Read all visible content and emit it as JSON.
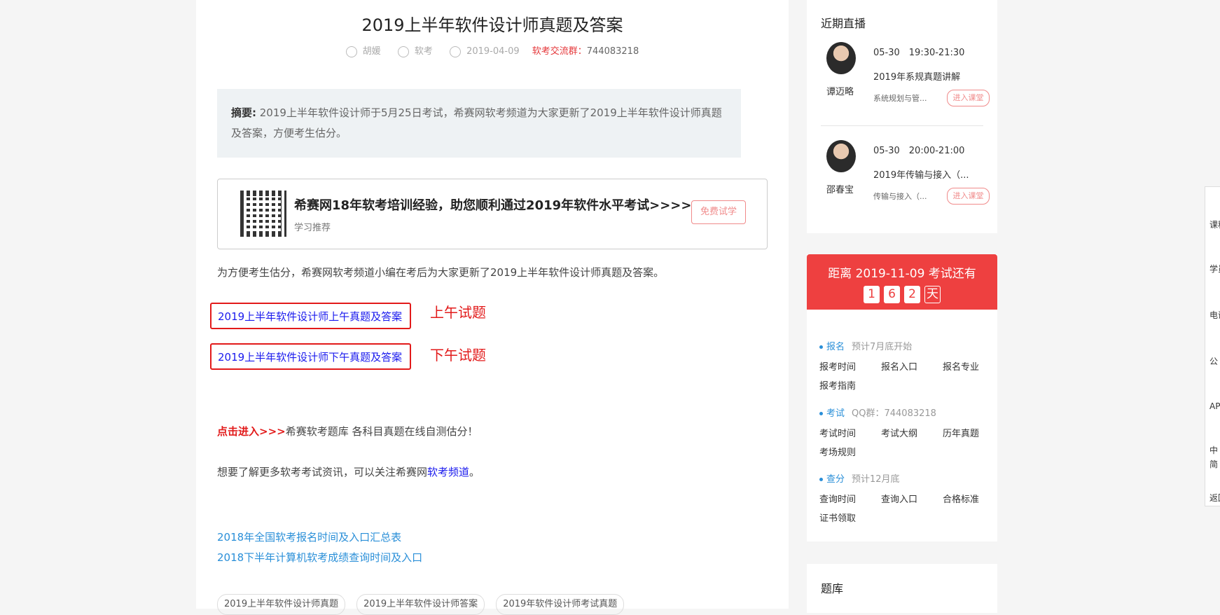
{
  "article": {
    "title": "2019上半年软件设计师真题及答案",
    "author": "胡媛",
    "category": "软考",
    "date": "2019-04-09",
    "group_label": "软考交流群：",
    "group_number": "744083218",
    "abstract_label": "摘要:",
    "abstract_text": " 2019上半年软件设计师于5月25日考试，希赛网软考频道为大家更新了2019上半年软件设计师真题及答案，方便考生估分。",
    "promo": {
      "title": "希赛网18年软考培训经验，助您顺利通过2019年软件水平考试>>>>",
      "subtitle": "学习推荐",
      "button": "免费试学"
    },
    "intro": "为方便考生估分，希赛网软考频道小编在考后为大家更新了2019上半年软件设计师真题及答案。",
    "link_morning": "2019上半年软件设计师上午真题及答案",
    "link_afternoon": "2019上半年软件设计师下午真题及答案",
    "label_morning": "上午试题",
    "label_afternoon": "下午试题",
    "cta_link": "点击进入>>>",
    "cta_text": "希赛软考题库 各科目真题在线自测估分！",
    "follow_text": "想要了解更多软考考试资讯，可以关注希赛网",
    "follow_link": "软考频道",
    "follow_end": "。",
    "related": [
      "2018年全国软考报名时间及入口汇总表",
      "2018下半年计算机软考成绩查询时间及入口"
    ],
    "tags": [
      "2019上半年软件设计师真题",
      "2019上半年软件设计师答案",
      "2019年软件设计师考试真题"
    ]
  },
  "live": {
    "heading": "近期直播",
    "items": [
      {
        "teacher": "谭迈略",
        "time": "05-30　19:30-21:30",
        "course": "2019年系规真题讲解",
        "sub": "系统规划与管...",
        "button": "进入课堂"
      },
      {
        "teacher": "邵春宝",
        "time": "05-30　20:00-21:00",
        "course": "2019年传输与接入（...",
        "sub": "传输与接入（...",
        "button": "进入课堂"
      }
    ]
  },
  "countdown": {
    "text": "距离 2019-11-09 考试还有",
    "digits": [
      "1",
      "6",
      "2"
    ],
    "unit": "天",
    "sections": [
      {
        "key": "报名",
        "note": "预计7月底开始",
        "links": [
          "报考时间",
          "报名入口",
          "报名专业",
          "报考指南"
        ]
      },
      {
        "key": "考试",
        "note": "QQ群：744083218",
        "links": [
          "考试时间",
          "考试大纲",
          "历年真题",
          "考场规则"
        ]
      },
      {
        "key": "查分",
        "note": "预计12月底",
        "links": [
          "查询时间",
          "查询入口",
          "合格标准",
          "证书领取"
        ]
      }
    ]
  },
  "bank": {
    "heading": "题库"
  },
  "floatbar": [
    "课程",
    "学员",
    "电话",
    "公",
    "APP",
    "中",
    "简",
    "返回"
  ]
}
